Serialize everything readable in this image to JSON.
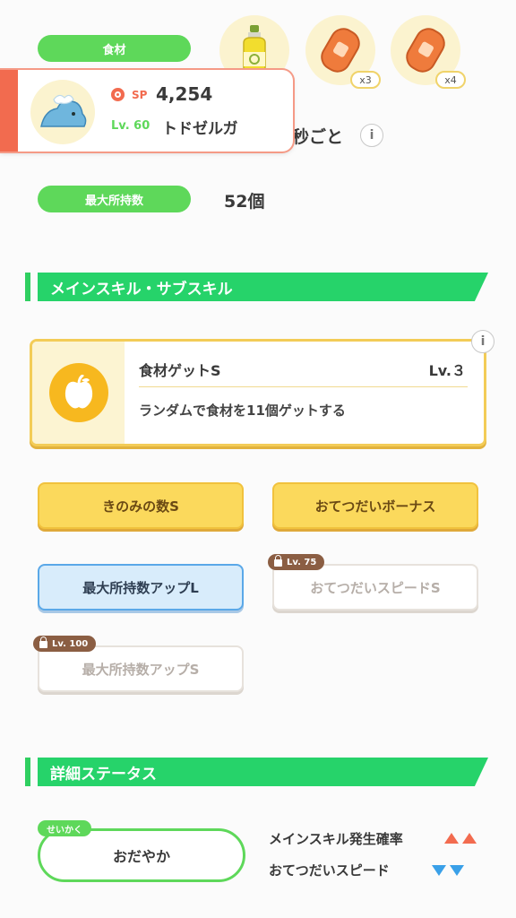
{
  "ingredients": {
    "label": "食材",
    "items": [
      {
        "icon": "oil-bottle-icon",
        "count": ""
      },
      {
        "icon": "sausage-icon",
        "count": "x3"
      },
      {
        "icon": "sausage-icon",
        "count": "x4"
      }
    ]
  },
  "popup": {
    "sp_label": "SP",
    "sp_value": "4,254",
    "level": "Lv. 60",
    "name": "トドゼルガ",
    "accent": "#f26b4f"
  },
  "help_time": {
    "partial_text": "秒ごと",
    "info": "i"
  },
  "max_carry": {
    "label": "最大所持数",
    "value": "52個"
  },
  "skills_section": {
    "title": "メインスキル・サブスキル"
  },
  "main_skill": {
    "name": "食材ゲットS",
    "level": "Lv.３",
    "description": "ランダムで食材を11個ゲットする",
    "info": "i"
  },
  "sub_skills": [
    {
      "label": "きのみの数S",
      "state": "gold",
      "lock": ""
    },
    {
      "label": "おてつだいボーナス",
      "state": "gold",
      "lock": ""
    },
    {
      "label": "最大所持数アップL",
      "state": "blue",
      "lock": ""
    },
    {
      "label": "おてつだいスピードS",
      "state": "locked",
      "lock": "Lv. 75"
    },
    {
      "label": "最大所持数アップS",
      "state": "locked",
      "lock": "Lv. 100"
    }
  ],
  "details_section": {
    "title": "詳細ステータス"
  },
  "nature": {
    "tag": "せいかく",
    "value": "おだやか",
    "effects": [
      {
        "label": "メインスキル発生確率",
        "direction": "up",
        "color": "#f26b4f"
      },
      {
        "label": "おてつだいスピード",
        "direction": "down",
        "color": "#3aa0e8"
      }
    ]
  },
  "colors": {
    "green": "#26d36a",
    "gold": "#fbd95c",
    "blue": "#d8ecfb"
  }
}
